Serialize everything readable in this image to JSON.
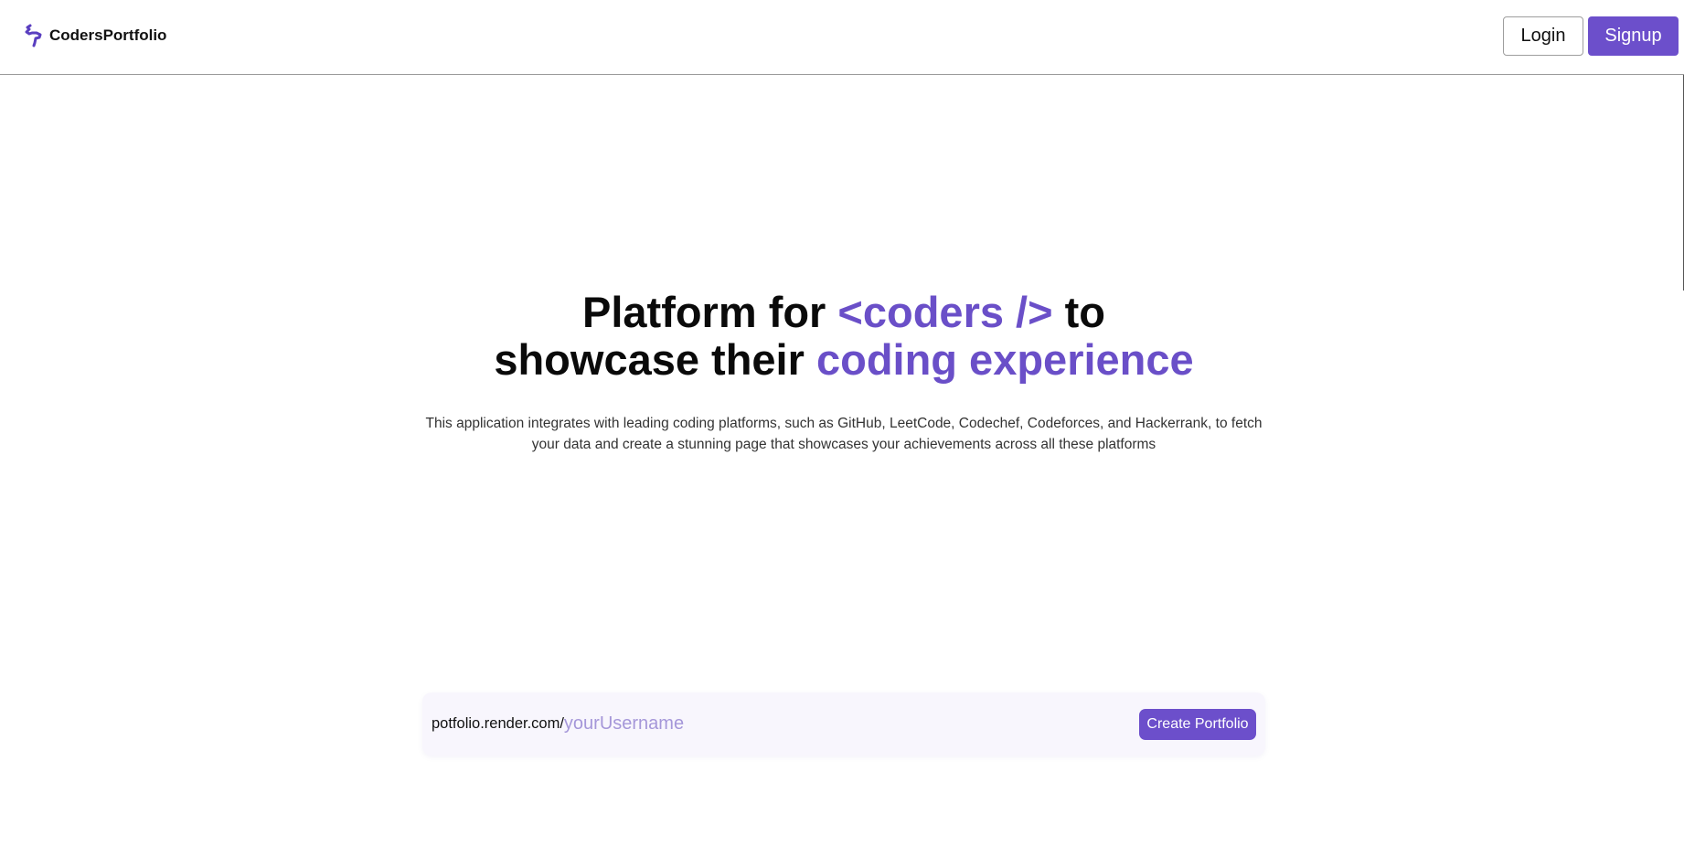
{
  "brand": {
    "name": "CodersPortfolio",
    "icon": "brand-s-logo-icon"
  },
  "nav": {
    "login_label": "Login",
    "signup_label": "Signup"
  },
  "hero": {
    "line1_a": "Platform for ",
    "line1_accent": "<coders />",
    "line1_b": " to",
    "line2_a": "showcase their ",
    "line2_accent": "coding experience",
    "description": "This application integrates with leading coding platforms, such as GitHub, LeetCode, Codechef, Codeforces, and Hackerrank, to fetch your data and create a stunning page that showcases your achievements across all these platforms"
  },
  "portfolio_form": {
    "url_prefix": "potfolio.render.com/",
    "username_placeholder": "yourUsername",
    "username_value": "",
    "submit_label": "Create Portfolio"
  },
  "colors": {
    "accent": "#6a4fc8",
    "button_bg": "#6c4fcb",
    "placeholder": "#a597d9"
  }
}
